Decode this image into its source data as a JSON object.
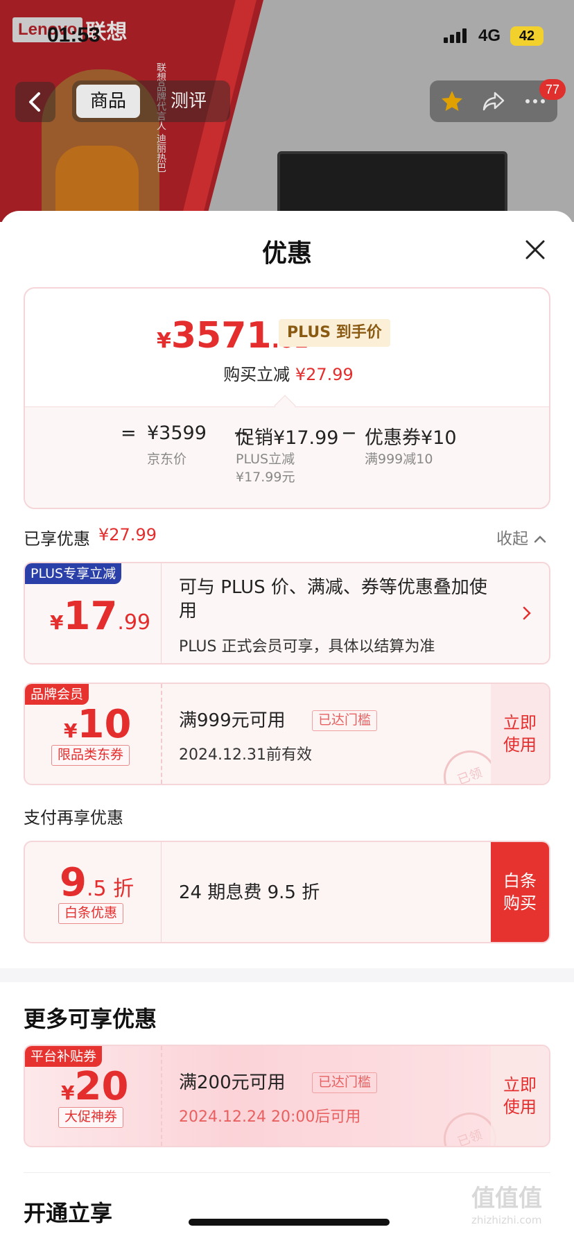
{
  "background": {
    "brand_en": "Lenovo",
    "brand_cn": "联想",
    "ambassador_text": "联想品牌代言人 迪丽热巴"
  },
  "status_bar": {
    "time": "01:53",
    "network": "4G",
    "battery": "42"
  },
  "nav": {
    "tabs": [
      {
        "label": "商品"
      },
      {
        "label": "测评"
      }
    ],
    "notification_count": "77"
  },
  "sheet": {
    "title": "优惠",
    "summary": {
      "currency": "¥",
      "price_int": "3571",
      "price_dec": ".01",
      "price_tag": "PLUS 到手价",
      "reduce_label": "购买立减",
      "reduce_value": "¥27.99",
      "formula": {
        "eq": "=",
        "jd_price": "¥3599",
        "jd_price_label": "京东价",
        "minus": "−",
        "promo": "促销¥17.99",
        "promo_label_1": "PLUS立减",
        "promo_label_2": "¥17.99元",
        "coupon": "优惠券¥10",
        "coupon_label": "满999减10"
      }
    },
    "enjoyed": {
      "label": "已享优惠",
      "value": "¥27.99",
      "collapse": "收起"
    },
    "card_plus": {
      "tag": "PLUS专享立减",
      "currency": "¥",
      "big": "17",
      "small": ".99",
      "text": "可与 PLUS 价、满减、券等优惠叠加使用",
      "sub": "PLUS 正式会员可享，具体以结算为准"
    },
    "card_brand": {
      "tag": "品牌会员",
      "currency": "¥",
      "big": "10",
      "chip": "限品类东券",
      "text": "满999元可用",
      "reached": "已达门槛",
      "sub": "2024.12.31前有效",
      "use_1": "立即",
      "use_2": "使用",
      "stamp": "已领"
    },
    "pay_section": "支付再享优惠",
    "card_baitiao": {
      "big": "9",
      "small": ".5 折",
      "chip": "白条优惠",
      "text": "24 期息费 9.5 折",
      "btn_1": "白条",
      "btn_2": "购买"
    },
    "more_section": "更多可享优惠",
    "card_platform": {
      "tag": "平台补贴券",
      "currency": "¥",
      "big": "20",
      "chip": "大促神券",
      "text": "满200元可用",
      "reached": "已达门槛",
      "sub": "2024.12.24 20:00后可用",
      "use_1": "立即",
      "use_2": "使用",
      "stamp": "已领"
    },
    "open_section": "开通立享"
  },
  "watermark": {
    "main": "值值值",
    "sub": "zhizhizhi.com"
  },
  "colors": {
    "accent_red": "#e42d2d",
    "plus_blue": "#2b3fa8",
    "tag_red": "#e6332f",
    "pink_border": "#f6d5d8"
  }
}
